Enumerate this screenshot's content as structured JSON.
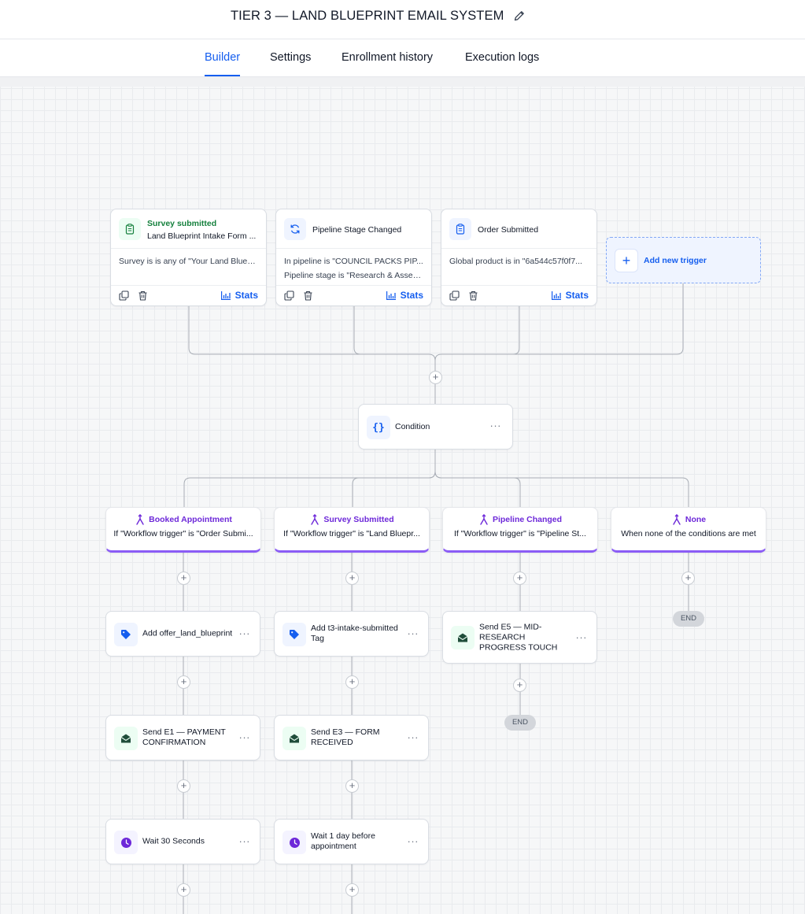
{
  "header": {
    "title": "TIER 3 — LAND BLUEPRINT EMAIL SYSTEM",
    "edit_icon": "pencil-icon"
  },
  "tabs": [
    {
      "label": "Builder",
      "active": true
    },
    {
      "label": "Settings",
      "active": false
    },
    {
      "label": "Enrollment history",
      "active": false
    },
    {
      "label": "Execution logs",
      "active": false
    }
  ],
  "triggers": [
    {
      "title": "Survey submitted",
      "subtitle": "Land Blueprint Intake Form ...",
      "icon": "clipboard-icon",
      "lines": [
        "Survey is is any of \"Your Land Bluep..."
      ],
      "stats_label": "Stats"
    },
    {
      "title": "Pipeline Stage Changed",
      "icon": "refresh-icon",
      "lines": [
        "In pipeline is \"COUNCIL PACKS PIP...",
        "Pipeline stage is \"Research & Asses..."
      ],
      "stats_label": "Stats"
    },
    {
      "title": "Order Submitted",
      "icon": "clipboard-icon",
      "lines": [
        "Global product is in \"6a544c57f0f7..."
      ],
      "stats_label": "Stats"
    }
  ],
  "add_trigger": {
    "label": "Add new trigger"
  },
  "condition": {
    "label": "Condition",
    "icon": "braces-icon"
  },
  "branches": [
    {
      "title": "Booked Appointment",
      "subtitle": "If \"Workflow trigger\" is \"Order Submi..."
    },
    {
      "title": "Survey Submitted",
      "subtitle": "If \"Workflow trigger\" is \"Land Bluepr..."
    },
    {
      "title": "Pipeline Changed",
      "subtitle": "If \"Workflow trigger\" is \"Pipeline St..."
    },
    {
      "title": "None",
      "subtitle": "When none of the conditions are met"
    }
  ],
  "actions": {
    "col1": [
      {
        "label": "Add offer_land_blueprint",
        "icon": "tag-icon"
      },
      {
        "label": "Send E1 — PAYMENT CONFIRMATION",
        "icon": "mail-icon"
      },
      {
        "label": "Wait 30 Seconds",
        "icon": "clock-icon"
      }
    ],
    "col2": [
      {
        "label": "Add t3-intake-submitted Tag",
        "icon": "tag-icon"
      },
      {
        "label": "Send E3 — FORM RECEIVED",
        "icon": "mail-icon"
      },
      {
        "label": "Wait 1 day before appointment",
        "icon": "clock-icon"
      }
    ],
    "col3": [
      {
        "label": "Send E5 — MID-RESEARCH PROGRESS TOUCH",
        "icon": "mail-icon"
      }
    ]
  },
  "end_label": "END",
  "colors": {
    "primary": "#155eef",
    "branch_accent": "#8b5cf6",
    "trigger_title": "#15803d"
  }
}
